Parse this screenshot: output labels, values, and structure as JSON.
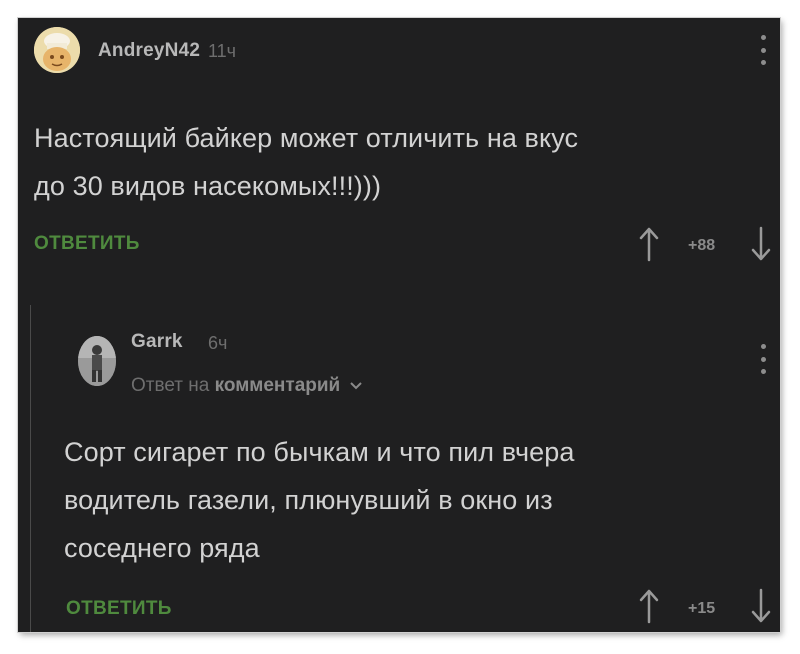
{
  "comments": [
    {
      "username": "AndreyN42",
      "time": "11ч",
      "text_lines": [
        "Настоящий байкер может отличить на вкус",
        "до 30 видов насекомых!!!)))"
      ],
      "reply_label": "ОТВЕТИТЬ",
      "rating": "+88"
    },
    {
      "username": "Garrk",
      "time": "6ч",
      "reply_to_prefix": "Ответ на",
      "reply_to_link": "комментарий",
      "text_lines": [
        "Сорт сигарет по бычкам и что пил вчера",
        "водитель газели, плюнувший в окно из",
        "соседнего ряда"
      ],
      "reply_label": "ОТВЕТИТЬ",
      "rating": "+15"
    }
  ],
  "colors": {
    "background": "#1f1f20",
    "text": "#d2d2d2",
    "username": "#b8b8b8",
    "muted": "#6e6e6e",
    "reply_green": "#4f8a3e"
  },
  "icons": [
    "more-vertical-icon",
    "arrow-up-icon",
    "arrow-down-icon",
    "chevron-down-icon"
  ]
}
